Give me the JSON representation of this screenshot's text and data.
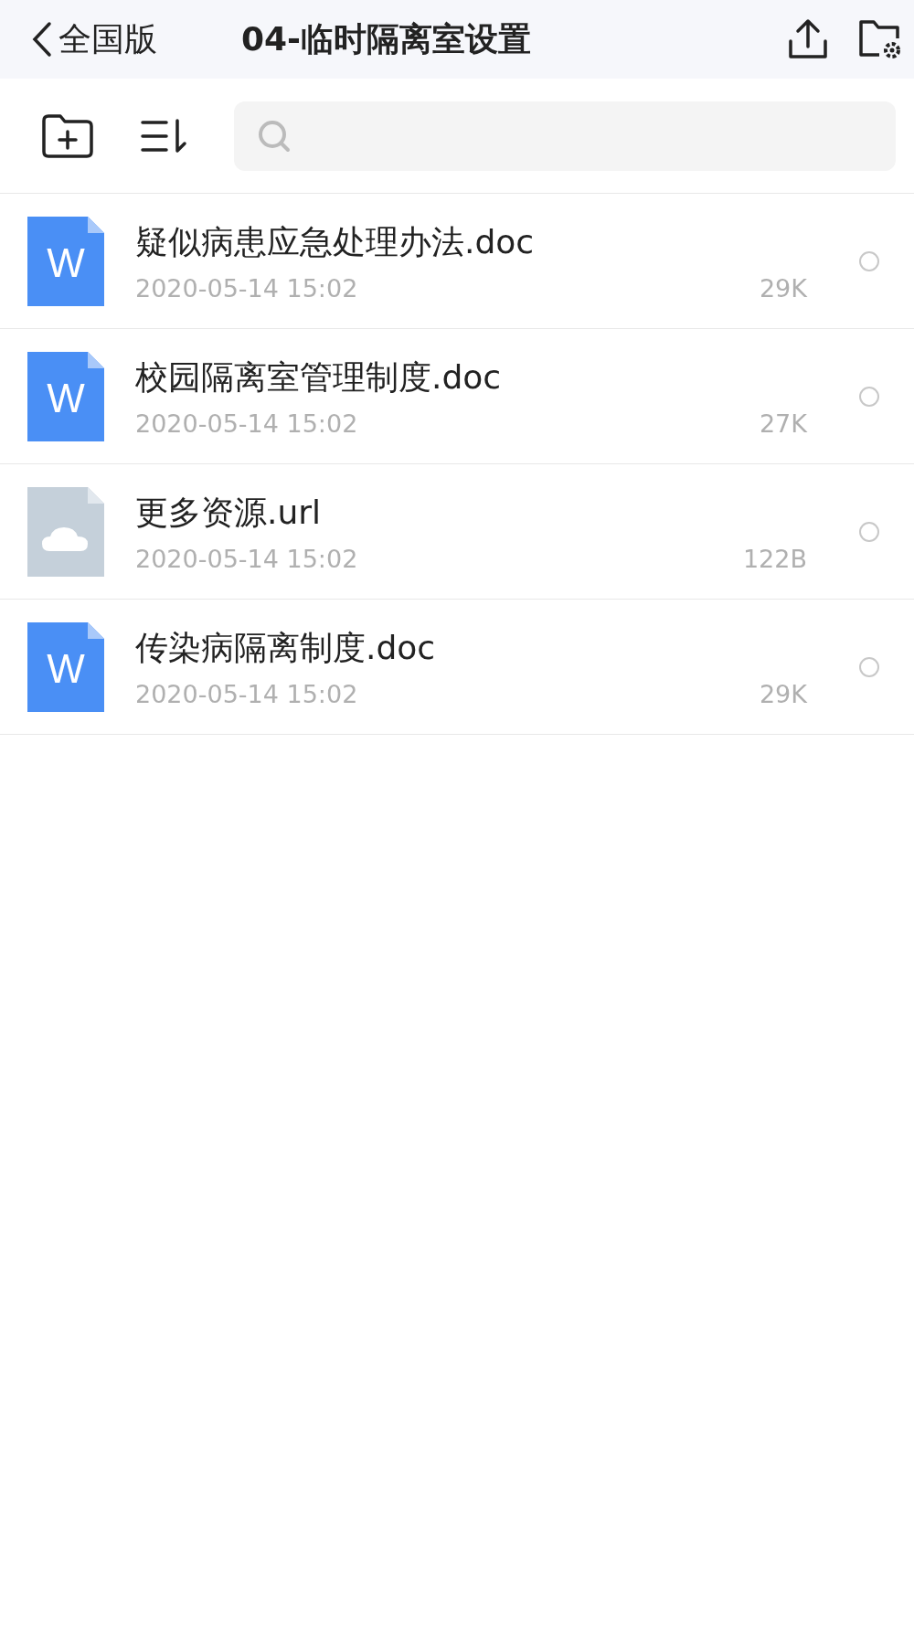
{
  "header": {
    "back_label": "全国版",
    "title": "04-临时隔离室设置"
  },
  "files": [
    {
      "kind": "doc",
      "icon_letter": "W",
      "name": "疑似病患应急处理办法.doc",
      "date": "2020-05-14 15:02",
      "size": "29K",
      "selected": false
    },
    {
      "kind": "doc",
      "icon_letter": "W",
      "name": "校园隔离室管理制度.doc",
      "date": "2020-05-14 15:02",
      "size": "27K",
      "selected": false
    },
    {
      "kind": "url",
      "name": "更多资源.url",
      "date": "2020-05-14 15:02",
      "size": "122B",
      "selected": false
    },
    {
      "kind": "doc",
      "icon_letter": "W",
      "name": "传染病隔离制度.doc",
      "date": "2020-05-14 15:02",
      "size": "29K",
      "selected": false
    }
  ]
}
